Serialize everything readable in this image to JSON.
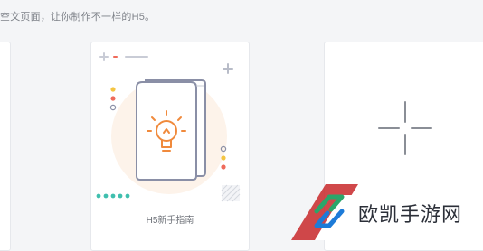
{
  "header": {
    "subtitle": "空文页面，让你制作不一样的H5。"
  },
  "cards": {
    "guide": {
      "label": "H5新手指南"
    }
  },
  "watermark": {
    "brand": "欧凯手游网"
  },
  "colors": {
    "background": "#f4f5f7",
    "card": "#ffffff",
    "border": "#e6e8ec",
    "bulb_orange": "#f08a3c",
    "book_outline": "#8a8fa6",
    "dot_teal": "#3fbfae",
    "dot_yellow": "#f4c542",
    "dot_red": "#ef6b5b",
    "brand_green": "#2aa66a",
    "brand_blue": "#1d7bd8",
    "brand_red": "#c8282a"
  }
}
